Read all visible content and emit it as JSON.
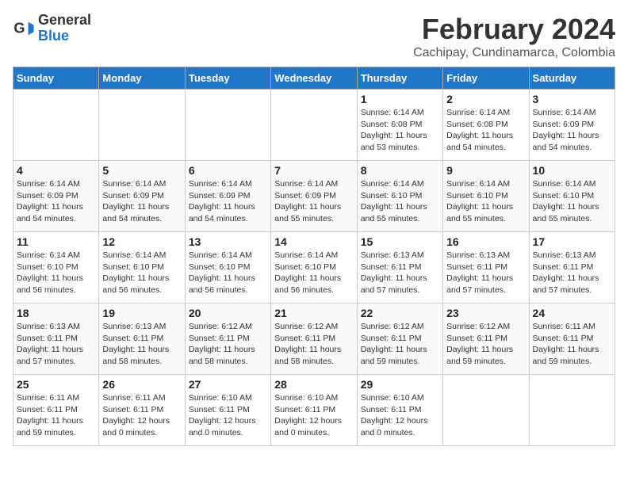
{
  "header": {
    "logo_general": "General",
    "logo_blue": "Blue",
    "month_title": "February 2024",
    "location": "Cachipay, Cundinamarca, Colombia"
  },
  "days_of_week": [
    "Sunday",
    "Monday",
    "Tuesday",
    "Wednesday",
    "Thursday",
    "Friday",
    "Saturday"
  ],
  "weeks": [
    [
      {
        "day": "",
        "info": ""
      },
      {
        "day": "",
        "info": ""
      },
      {
        "day": "",
        "info": ""
      },
      {
        "day": "",
        "info": ""
      },
      {
        "day": "1",
        "info": "Sunrise: 6:14 AM\nSunset: 6:08 PM\nDaylight: 11 hours\nand 53 minutes."
      },
      {
        "day": "2",
        "info": "Sunrise: 6:14 AM\nSunset: 6:08 PM\nDaylight: 11 hours\nand 54 minutes."
      },
      {
        "day": "3",
        "info": "Sunrise: 6:14 AM\nSunset: 6:09 PM\nDaylight: 11 hours\nand 54 minutes."
      }
    ],
    [
      {
        "day": "4",
        "info": "Sunrise: 6:14 AM\nSunset: 6:09 PM\nDaylight: 11 hours\nand 54 minutes."
      },
      {
        "day": "5",
        "info": "Sunrise: 6:14 AM\nSunset: 6:09 PM\nDaylight: 11 hours\nand 54 minutes."
      },
      {
        "day": "6",
        "info": "Sunrise: 6:14 AM\nSunset: 6:09 PM\nDaylight: 11 hours\nand 54 minutes."
      },
      {
        "day": "7",
        "info": "Sunrise: 6:14 AM\nSunset: 6:09 PM\nDaylight: 11 hours\nand 55 minutes."
      },
      {
        "day": "8",
        "info": "Sunrise: 6:14 AM\nSunset: 6:10 PM\nDaylight: 11 hours\nand 55 minutes."
      },
      {
        "day": "9",
        "info": "Sunrise: 6:14 AM\nSunset: 6:10 PM\nDaylight: 11 hours\nand 55 minutes."
      },
      {
        "day": "10",
        "info": "Sunrise: 6:14 AM\nSunset: 6:10 PM\nDaylight: 11 hours\nand 55 minutes."
      }
    ],
    [
      {
        "day": "11",
        "info": "Sunrise: 6:14 AM\nSunset: 6:10 PM\nDaylight: 11 hours\nand 56 minutes."
      },
      {
        "day": "12",
        "info": "Sunrise: 6:14 AM\nSunset: 6:10 PM\nDaylight: 11 hours\nand 56 minutes."
      },
      {
        "day": "13",
        "info": "Sunrise: 6:14 AM\nSunset: 6:10 PM\nDaylight: 11 hours\nand 56 minutes."
      },
      {
        "day": "14",
        "info": "Sunrise: 6:14 AM\nSunset: 6:10 PM\nDaylight: 11 hours\nand 56 minutes."
      },
      {
        "day": "15",
        "info": "Sunrise: 6:13 AM\nSunset: 6:11 PM\nDaylight: 11 hours\nand 57 minutes."
      },
      {
        "day": "16",
        "info": "Sunrise: 6:13 AM\nSunset: 6:11 PM\nDaylight: 11 hours\nand 57 minutes."
      },
      {
        "day": "17",
        "info": "Sunrise: 6:13 AM\nSunset: 6:11 PM\nDaylight: 11 hours\nand 57 minutes."
      }
    ],
    [
      {
        "day": "18",
        "info": "Sunrise: 6:13 AM\nSunset: 6:11 PM\nDaylight: 11 hours\nand 57 minutes."
      },
      {
        "day": "19",
        "info": "Sunrise: 6:13 AM\nSunset: 6:11 PM\nDaylight: 11 hours\nand 58 minutes."
      },
      {
        "day": "20",
        "info": "Sunrise: 6:12 AM\nSunset: 6:11 PM\nDaylight: 11 hours\nand 58 minutes."
      },
      {
        "day": "21",
        "info": "Sunrise: 6:12 AM\nSunset: 6:11 PM\nDaylight: 11 hours\nand 58 minutes."
      },
      {
        "day": "22",
        "info": "Sunrise: 6:12 AM\nSunset: 6:11 PM\nDaylight: 11 hours\nand 59 minutes."
      },
      {
        "day": "23",
        "info": "Sunrise: 6:12 AM\nSunset: 6:11 PM\nDaylight: 11 hours\nand 59 minutes."
      },
      {
        "day": "24",
        "info": "Sunrise: 6:11 AM\nSunset: 6:11 PM\nDaylight: 11 hours\nand 59 minutes."
      }
    ],
    [
      {
        "day": "25",
        "info": "Sunrise: 6:11 AM\nSunset: 6:11 PM\nDaylight: 11 hours\nand 59 minutes."
      },
      {
        "day": "26",
        "info": "Sunrise: 6:11 AM\nSunset: 6:11 PM\nDaylight: 12 hours\nand 0 minutes."
      },
      {
        "day": "27",
        "info": "Sunrise: 6:10 AM\nSunset: 6:11 PM\nDaylight: 12 hours\nand 0 minutes."
      },
      {
        "day": "28",
        "info": "Sunrise: 6:10 AM\nSunset: 6:11 PM\nDaylight: 12 hours\nand 0 minutes."
      },
      {
        "day": "29",
        "info": "Sunrise: 6:10 AM\nSunset: 6:11 PM\nDaylight: 12 hours\nand 0 minutes."
      },
      {
        "day": "",
        "info": ""
      },
      {
        "day": "",
        "info": ""
      }
    ]
  ]
}
